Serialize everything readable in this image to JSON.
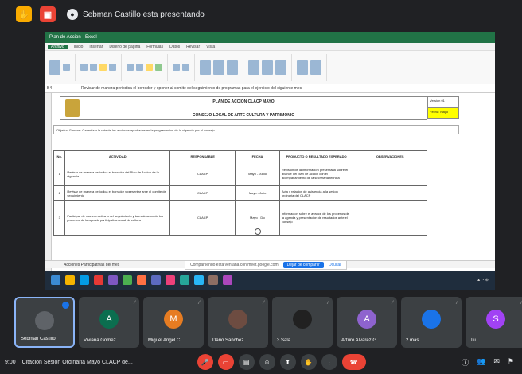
{
  "meet": {
    "presenter_text": "Sebman Castillo esta presentando",
    "time": "9:00",
    "meeting_name": "Citacion Sesion Ordinaria Mayo CLACP de..."
  },
  "excel": {
    "title": "Plan de Accion - Excel",
    "tabs": [
      "Archivo",
      "Inicio",
      "Insertar",
      "Diseno de pagina",
      "Formulas",
      "Datos",
      "Revisar",
      "Vista"
    ],
    "name_box": "B4",
    "formula": "Revisar de manera periodica el borrador y oponer al comite del seguimiento de programas para el ejercicio del siguiente mes",
    "header_title_1": "PLAN DE ACCION CLACP MAYO",
    "header_title_2": "CONSEJO LOCAL DE ARTE CULTURA Y PATRIMONIO",
    "side_cell_top": "Version 01",
    "side_cell_yellow": "Fecha: mayo",
    "objective": "Objetivo General: Garantizar la ruta de las acciones aprobadas en la programacion de la vigencia por el consejo",
    "columns": [
      "No.",
      "ACTIVIDAD",
      "RESPONSABLE",
      "FECHA",
      "PRODUCTO O RESULTADO ESPERADO",
      "OBSERVACIONES"
    ],
    "rows": [
      {
        "num": "1",
        "actividad": "Revisar de manera periodica el borrador del Plan de Accion de la vigencia",
        "responsable": "CLACP",
        "fecha": "Mayo - Junio",
        "producto": "Revision de la informacion presentada sobre el avance del plan de accion con el acompanamiento de la secretaria tecnica",
        "obs": ""
      },
      {
        "num": "2",
        "actividad": "Revisar de manera periodica el borrador y presentar ante el comite de seguimiento",
        "responsable": "CLACP",
        "fecha": "Mayo - Julio",
        "producto": "Acta y relacion de asistencia a la sesion ordinaria del CLACP",
        "obs": ""
      },
      {
        "num": "3",
        "actividad": "Participar de manera activa en el seguimiento y la evaluacion de los procesos de la agenda participativa anual de cultura",
        "responsable": "CLACP",
        "fecha": "Mayo - Dic",
        "producto": "Informacion sobre el avance de los procesos de la agenda y presentacion de resultados ante el consejo",
        "obs": ""
      }
    ],
    "sheet_tab": "Acciones Participativas del mes",
    "share_text": "Compartiendo esta ventana con meet.google.com",
    "share_stop": "Dejar de compartir",
    "share_hide": "Ocultar"
  },
  "participants": [
    {
      "name": "Sebman Castillo",
      "initial": "",
      "color": "#5f6368",
      "speaking": true
    },
    {
      "name": "Viviana Gomez",
      "initial": "A",
      "color": "#0b6e4f",
      "speaking": false
    },
    {
      "name": "Miguel Angel C...",
      "initial": "M",
      "color": "#e67c22",
      "speaking": false
    },
    {
      "name": "Dario Sanchez",
      "initial": "",
      "color": "#6d4c41",
      "speaking": false
    },
    {
      "name": "3 Sala",
      "initial": "",
      "color": "#212121",
      "speaking": false
    },
    {
      "name": "Arturo Alvarez G.",
      "initial": "A",
      "color": "#8e63ce",
      "speaking": false
    },
    {
      "name": "2 mas",
      "initial": "",
      "color": "#1a73e8",
      "speaking": false
    },
    {
      "name": "Tu",
      "initial": "S",
      "color": "#a142f4",
      "speaking": false
    }
  ],
  "colors": {
    "excel_green": "#217346",
    "meet_red": "#ea4335",
    "meet_bg": "#202124",
    "tile_bg": "#3c4043"
  }
}
